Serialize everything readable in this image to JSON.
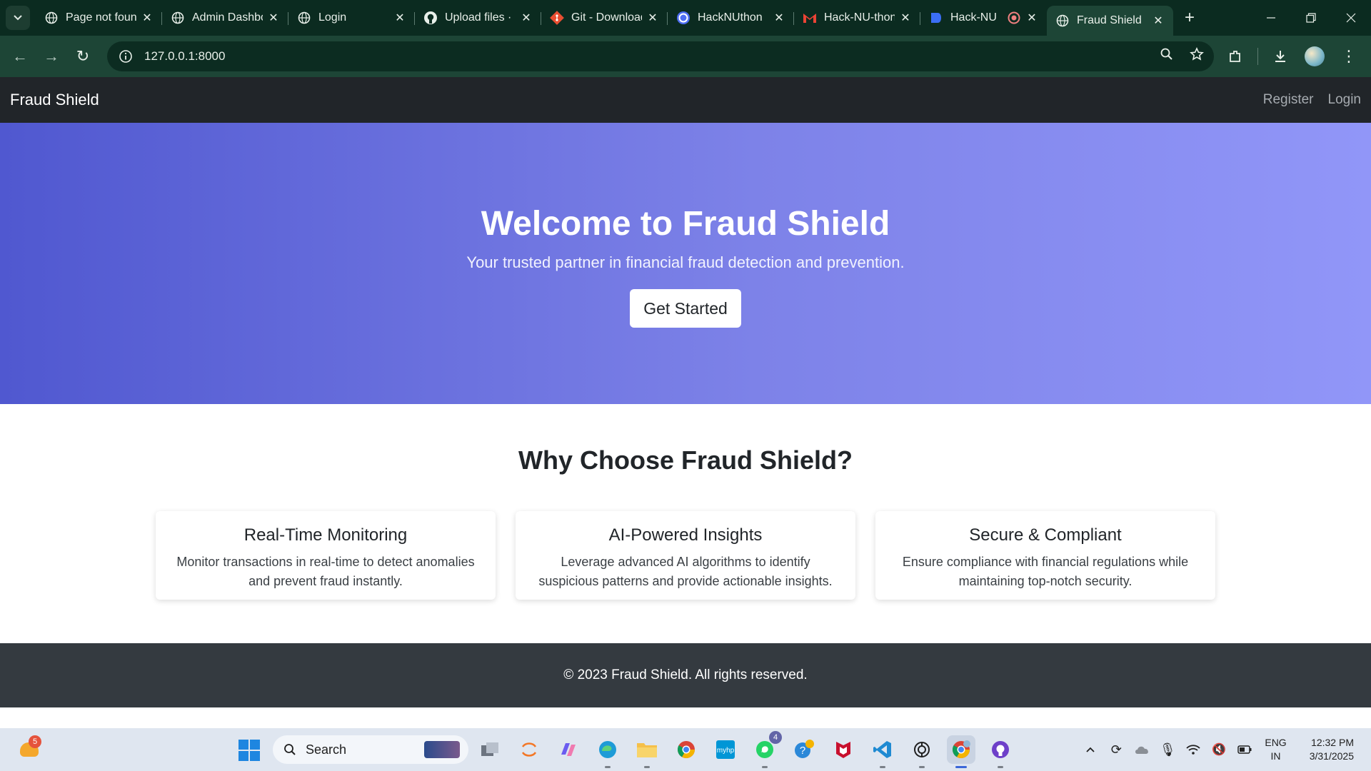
{
  "browser": {
    "tabs": [
      {
        "title": "Page not found",
        "icon": "globe-icon",
        "active": false
      },
      {
        "title": "Admin Dashboard",
        "icon": "globe-icon",
        "active": false
      },
      {
        "title": "Login",
        "icon": "globe-icon",
        "active": false
      },
      {
        "title": "Upload files ·",
        "icon": "github-icon",
        "active": false
      },
      {
        "title": "Git - Downloads",
        "icon": "git-icon",
        "active": false
      },
      {
        "title": "HackNUthon",
        "icon": "hacknuthon-icon",
        "active": false
      },
      {
        "title": "Hack-NU-thon",
        "icon": "gmail-icon",
        "active": false
      },
      {
        "title": "Hack-NU",
        "icon": "docs-icon",
        "active": false
      },
      {
        "title": "Fraud Shield",
        "icon": "globe-icon",
        "active": true
      }
    ],
    "url": "127.0.0.1:8000",
    "theme_color": "#1d4536"
  },
  "site": {
    "brand": "Fraud Shield",
    "nav": {
      "register": "Register",
      "login": "Login"
    },
    "hero": {
      "title": "Welcome to Fraud Shield",
      "subtitle": "Your trusted partner in financial fraud detection and prevention.",
      "cta": "Get Started",
      "gradient_start": "#5058d0",
      "gradient_end": "#9196f8"
    },
    "features": {
      "heading": "Why Choose Fraud Shield?",
      "cards": [
        {
          "title": "Real-Time Monitoring",
          "text": "Monitor transactions in real-time to detect anomalies and prevent fraud instantly."
        },
        {
          "title": "AI-Powered Insights",
          "text": "Leverage advanced AI algorithms to identify suspicious patterns and provide actionable insights."
        },
        {
          "title": "Secure & Compliant",
          "text": "Ensure compliance with financial regulations while maintaining top-notch security."
        }
      ]
    },
    "footer": "© 2023 Fraud Shield. All rights reserved."
  },
  "taskbar": {
    "weather_badge": "5",
    "search_placeholder": "Search",
    "whatsapp_badge": "4",
    "lang_primary": "ENG",
    "lang_region": "IN",
    "time": "12:32 PM",
    "date": "3/31/2025"
  }
}
